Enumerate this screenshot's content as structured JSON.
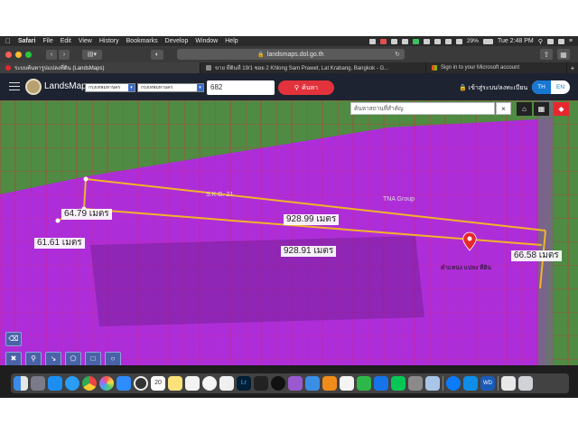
{
  "menubar": {
    "items": [
      "Safari",
      "File",
      "Edit",
      "View",
      "History",
      "Bookmarks",
      "Develop",
      "Window",
      "Help"
    ],
    "battery": "29%",
    "clock": "Tue 2:48 PM"
  },
  "browser": {
    "url": "landsmaps.dol.go.th",
    "tabs": [
      {
        "label": "ระบบค้นหารูปแปลงที่ดิน (LandsMaps)",
        "active": true
      },
      {
        "label": "ขาย ที่ดินที่ 19/1 ซอย 2 Khlong Sam Prawet, Lat Krabang, Bangkok - G...",
        "active": false
      },
      {
        "label": "Sign in to your Microsoft account",
        "active": false
      }
    ]
  },
  "app": {
    "brand": "LandsMaps",
    "province_select": "กรุงเทพมหานคร",
    "district_select": "กรุงเทพมหานคร",
    "parcel_number": "682",
    "search_button": "ค้นหา",
    "login": "เข้าสู่ระบบ/ลงทะเบียน",
    "lang_th": "TH",
    "lang_en": "EN"
  },
  "map": {
    "search_placeholder": "ค้นหาสถานที่สำคัญ",
    "close_symbol": "×",
    "measurements": {
      "top_left": "64.79 เมตร",
      "left": "61.61 เมตร",
      "top_center": "928.99 เมตร",
      "bottom_center": "928.91 เมตร",
      "right": "66.58 เมตร"
    },
    "pin_label": "ตำแหน่ง แปลง ที่ดิน",
    "place_label": "S.K.G. 21",
    "place_label_2": "TNA Group",
    "colors": {
      "parcel_fill": "#b526e6",
      "measure_line": "#f0b429",
      "pin": "#e8262f",
      "grid_line": "#e0243a"
    }
  },
  "dock": {
    "icons": [
      "finder-icon",
      "launchpad-icon",
      "appstore-icon",
      "safari-icon",
      "chrome-icon",
      "photos-icon",
      "zoom-icon",
      "maps-icon",
      "calendar-icon",
      "notes-icon",
      "reminders-icon",
      "music-icon",
      "pages-icon",
      "lightroom-icon",
      "terminal-icon",
      "appletv-icon",
      "podcasts-icon",
      "mail-icon",
      "books-icon",
      "textedit-icon",
      "numbers-icon",
      "keynote-icon",
      "line-icon",
      "systemprefs-icon",
      "preview-icon",
      "messenger-icon",
      "teamviewer-icon",
      "wd-icon",
      "document-icon",
      "trash-icon"
    ],
    "calendar_day": "20"
  }
}
